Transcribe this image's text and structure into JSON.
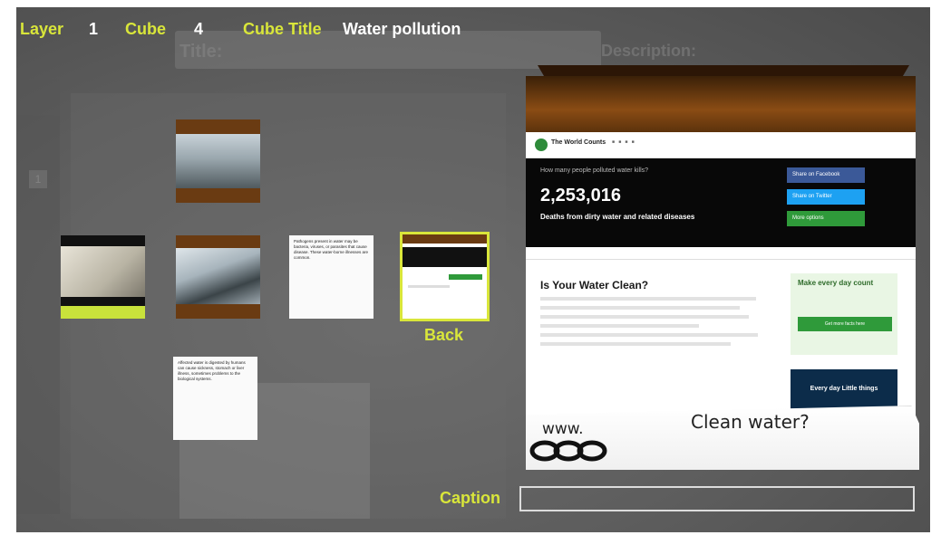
{
  "hud": {
    "layer_label": "Layer",
    "layer_value": "1",
    "cube_label": "Cube",
    "cube_value": "4",
    "cube_title_label": "Cube Title",
    "cube_title_value": "Water pollution"
  },
  "background": {
    "title_label": "Title:",
    "description_label": "Description:",
    "sidebar_number": "1"
  },
  "thumbnails": {
    "note1_text": "Pathogens present in water may be bacteria, viruses, or parasites that cause disease. These water-borne illnesses are common.",
    "note2_text": "Affected water is digested by humans can cause sickness, stomach or liver illness, sometimes problems to the biological systems.",
    "back_label": "Back"
  },
  "cube_face": {
    "site_name": "The World Counts",
    "hero_question": "How many people polluted water kills?",
    "hero_number": "2,253,016",
    "hero_subtitle": "Deaths from dirty water and related diseases",
    "share_buttons": [
      "Share on Facebook",
      "Share on Twitter",
      "More options"
    ],
    "article_title": "Is Your Water Clean?",
    "side_box_title": "Make every day count",
    "side_box_button": "Get more facts here",
    "dark_box_text": "Every day Little things"
  },
  "peel": {
    "www_text": "www.",
    "question_text": "Clean water?"
  },
  "caption": {
    "label": "Caption",
    "value": ""
  }
}
